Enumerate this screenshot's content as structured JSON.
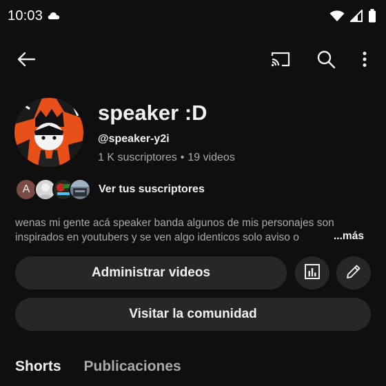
{
  "status_bar": {
    "time": "10:03",
    "icons": [
      "cloud-icon",
      "wifi-icon",
      "signal-icon",
      "battery-icon"
    ]
  },
  "app_bar": {
    "icons": [
      "back-arrow-icon",
      "cast-icon",
      "search-icon",
      "more-vert-icon"
    ]
  },
  "channel": {
    "name": "speaker :D",
    "handle": "@speaker-y2i",
    "subscribers": "1 K suscriptores",
    "separator": "•",
    "videos": "19 videos"
  },
  "subscribers_row": {
    "first_initial": "A",
    "link_label": "Ver tus suscriptores"
  },
  "description": {
    "line1": "wenas mi gente acá speaker banda algunos de mis personajes son",
    "line2": "inspirados en youtubers y se ven algo identicos solo aviso o",
    "more_label": "...más"
  },
  "actions": {
    "manage_label": "Administrar videos",
    "community_label": "Visitar la comunidad"
  },
  "tabs": [
    {
      "label": "Shorts",
      "active": true
    },
    {
      "label": "Publicaciones",
      "active": false
    }
  ],
  "colors": {
    "background": "#0f0f0f",
    "button_bg": "#272727",
    "primary_text": "#f1f1f1",
    "secondary_text": "#aaaaaa",
    "avatar_orange": "#e8501a"
  }
}
